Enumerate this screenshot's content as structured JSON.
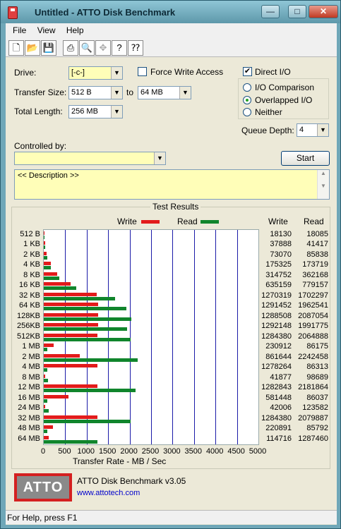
{
  "window": {
    "title": "Untitled - ATTO Disk Benchmark",
    "minimize": "—",
    "maximize": "□",
    "close": "✕"
  },
  "menu": [
    "File",
    "View",
    "Help"
  ],
  "toolbar": [
    "new-icon",
    "open-icon",
    "save-icon",
    "print-icon",
    "print-preview-icon",
    "move-icon",
    "help-icon",
    "context-help-icon"
  ],
  "settings": {
    "drive_label": "Drive:",
    "drive_value": "[-c-]",
    "force_write_label": "Force Write Access",
    "force_write_checked": false,
    "direct_io_label": "Direct I/O",
    "direct_io_checked": true,
    "transfer_size_label": "Transfer Size:",
    "transfer_from": "512 B",
    "to_label": "to",
    "transfer_to": "64 MB",
    "total_length_label": "Total Length:",
    "total_length": "256 MB",
    "io_comparison": "I/O Comparison",
    "overlapped_io": "Overlapped I/O",
    "neither": "Neither",
    "selected_mode": "overlapped",
    "queue_depth_label": "Queue Depth:",
    "queue_depth": "4",
    "controlled_by_label": "Controlled by:",
    "controlled_by_value": "",
    "start_label": "Start",
    "description": "<< Description >>"
  },
  "results": {
    "title": "Test Results",
    "write_legend": "Write",
    "read_legend": "Read",
    "write_col": "Write",
    "read_col": "Read",
    "colors": {
      "write": "#e21b1b",
      "read": "#10852c",
      "grid": "#1a1aa8"
    }
  },
  "chart_data": {
    "type": "bar",
    "orientation": "horizontal",
    "title": "Test Results",
    "xlabel": "Transfer Rate - MB / Sec",
    "xlim": [
      0,
      5000
    ],
    "xticks": [
      "0",
      "500",
      "1000",
      "1500",
      "2000",
      "2500",
      "3000",
      "3500",
      "4000",
      "4500",
      "5000"
    ],
    "legend": "top",
    "grid": true,
    "categories": [
      "512 B",
      "1 KB",
      "2 KB",
      "4 KB",
      "8 KB",
      "16 KB",
      "32 KB",
      "64 KB",
      "128KB",
      "256KB",
      "512KB",
      "1 MB",
      "2 MB",
      "4 MB",
      "8 MB",
      "12 MB",
      "16 MB",
      "24 MB",
      "32 MB",
      "48 MB",
      "64 MB"
    ],
    "series": [
      {
        "name": "Write",
        "values": [
          18130,
          37888,
          73070,
          175325,
          314752,
          635159,
          1270319,
          1291452,
          1288508,
          1292148,
          1284380,
          230912,
          861644,
          1278264,
          41877,
          1282843,
          581448,
          42006,
          1284380,
          220891,
          114716
        ]
      },
      {
        "name": "Read",
        "values": [
          18085,
          41417,
          85838,
          173719,
          362168,
          779157,
          1702297,
          1962541,
          2087054,
          1991775,
          2064888,
          86175,
          2242458,
          86313,
          98689,
          2181864,
          86037,
          123582,
          2079887,
          85792,
          1287460
        ]
      }
    ]
  },
  "footer": {
    "logo": "ATTO",
    "product": "ATTO Disk Benchmark v3.05",
    "url": "www.attotech.com"
  },
  "status": "For Help, press F1"
}
